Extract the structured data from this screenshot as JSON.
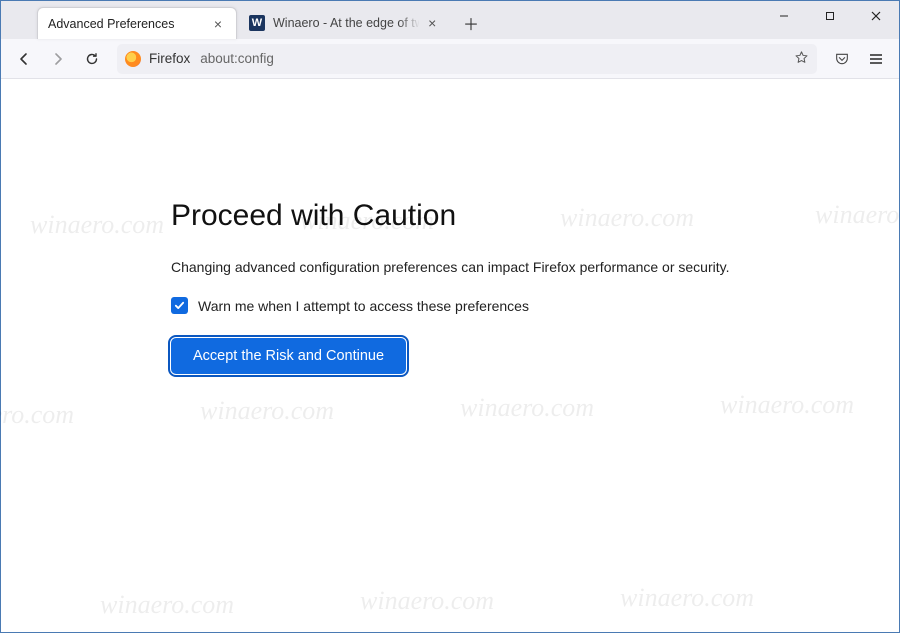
{
  "window": {
    "tabs": [
      {
        "title": "Advanced Preferences",
        "active": true
      },
      {
        "title": "Winaero - At the edge of tweak",
        "active": false,
        "favicon_letter": "W",
        "favicon_bg": "#1b355f",
        "favicon_fg": "#ffffff"
      }
    ]
  },
  "urlbar": {
    "identity_label": "Firefox",
    "url_text": "about:config"
  },
  "page": {
    "heading": "Proceed with Caution",
    "description": "Changing advanced configuration preferences can impact Firefox performance or security.",
    "checkbox_label": "Warn me when I attempt to access these preferences",
    "checkbox_checked": true,
    "accept_button": "Accept the Risk and Continue"
  },
  "watermark": "winaero.com"
}
